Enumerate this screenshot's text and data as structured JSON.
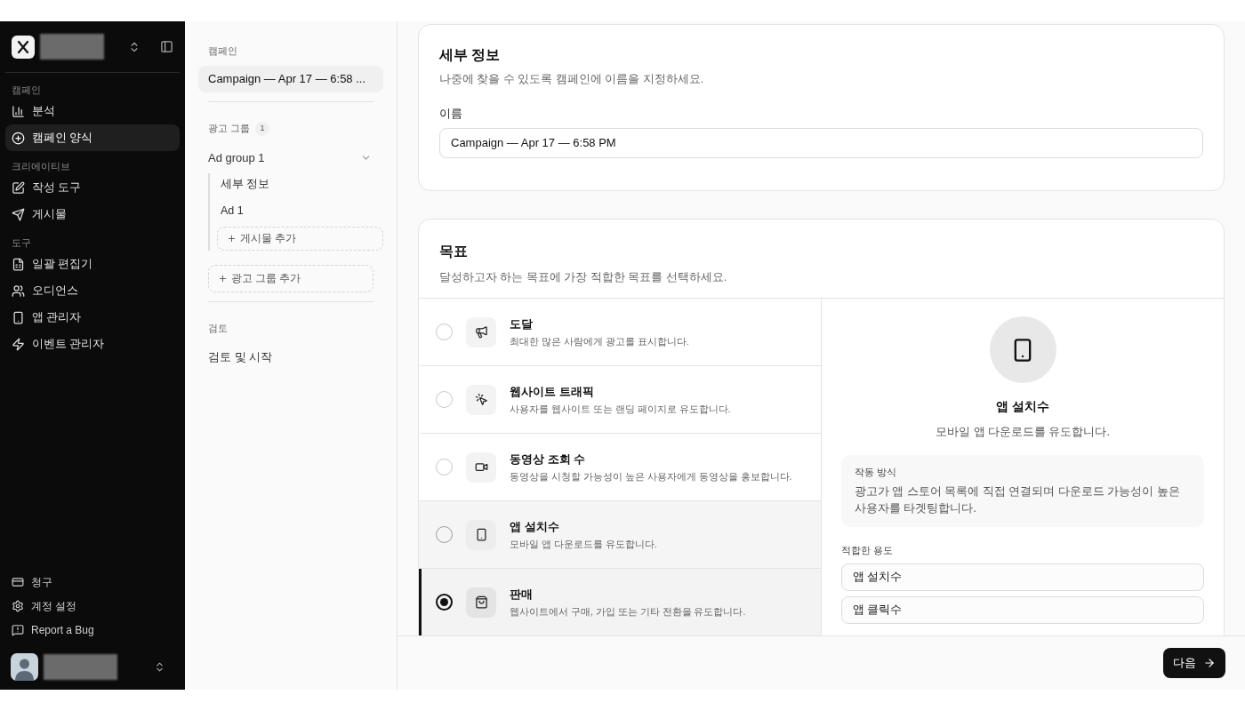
{
  "sidebar": {
    "sections": [
      {
        "heading": "캠페인",
        "items": [
          {
            "label": "분석",
            "selected": false
          },
          {
            "label": "캠페인 양식",
            "selected": true
          }
        ]
      },
      {
        "heading": "크리에이티브",
        "items": [
          {
            "label": "작성 도구",
            "selected": false
          },
          {
            "label": "게시물",
            "selected": false
          }
        ]
      },
      {
        "heading": "도구",
        "items": [
          {
            "label": "일괄 편집기",
            "selected": false
          },
          {
            "label": "오디언스",
            "selected": false
          },
          {
            "label": "앱 관리자",
            "selected": false
          },
          {
            "label": "이벤트 관리자",
            "selected": false
          }
        ]
      }
    ],
    "footer_items": [
      {
        "label": "청구"
      },
      {
        "label": "계정 설정"
      },
      {
        "label": "Report a Bug"
      }
    ]
  },
  "steps": {
    "campaign_heading": "캠페인",
    "campaign": {
      "label": "Campaign — Apr 17 — 6:58 ...",
      "selected": true
    },
    "ad_groups_heading": "광고 그룹",
    "ad_groups_count": "1",
    "ad_group": {
      "label": "Ad group 1",
      "expanded": true,
      "children": [
        {
          "label": "세부 정보"
        },
        {
          "label": "Ad 1"
        }
      ],
      "add_post": "게시물 추가"
    },
    "add_ad_group": "광고 그룹 추가",
    "review_heading": "검토",
    "review_item": "검토 및 시작"
  },
  "details": {
    "title": "세부 정보",
    "description": "나중에 찾을 수 있도록 캠페인에 이름을 지정하세요.",
    "name_label": "이름",
    "name_value": "Campaign — Apr 17 — 6:58 PM"
  },
  "objective": {
    "title": "목표",
    "description": "달성하고자 하는 목표에 가장 적합한 목표를 선택하세요.",
    "options": [
      {
        "title": "도달",
        "description": "최대한 많은 사람에게 광고를 표시합니다.",
        "selected": false,
        "hovered": false
      },
      {
        "title": "웹사이트 트래픽",
        "description": "사용자를 웹사이트 또는 랜딩 페이지로 유도합니다.",
        "selected": false,
        "hovered": false
      },
      {
        "title": "동영상 조회 수",
        "description": "동영상을 시청할 가능성이 높은 사용자에게 동영상을 홍보합니다.",
        "selected": false,
        "hovered": false
      },
      {
        "title": "앱 설치수",
        "description": "모바일 앱 다운로드를 유도합니다.",
        "selected": false,
        "hovered": true
      },
      {
        "title": "판매",
        "description": "웹사이트에서 구매, 가입 또는 기타 전환을 유도합니다.",
        "selected": true,
        "hovered": false
      }
    ],
    "preview": {
      "title": "앱 설치수",
      "description": "모바일 앱 다운로드를 유도합니다.",
      "how_heading": "작동 방식",
      "how_text": "광고가 앱 스토어 목록에 직접 연결되며 다운로드 가능성이 높은 사용자를 타겟팅합니다.",
      "fit_heading": "적합한 용도",
      "fit_items": [
        "앱 설치수",
        "앱 클릭수"
      ]
    }
  },
  "footer": {
    "next_button": "다음"
  }
}
